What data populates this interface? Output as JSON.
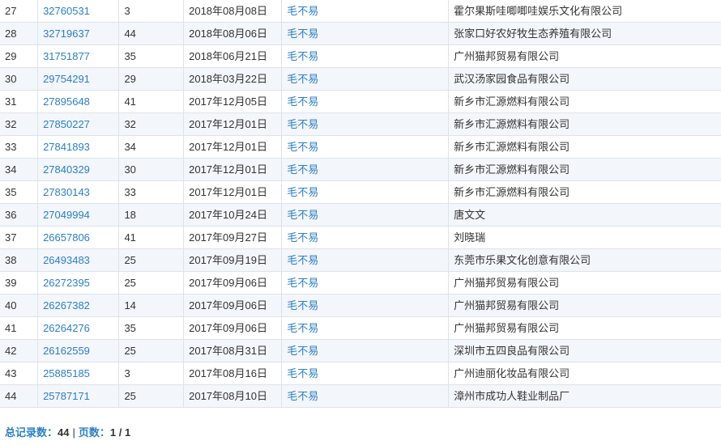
{
  "rows": [
    {
      "index": "27",
      "reg_no": "32760531",
      "class": "3",
      "date": "2018年08月08日",
      "status": "毛不易",
      "applicant": "霍尔果斯哇唧唧哇娱乐文化有限公司"
    },
    {
      "index": "28",
      "reg_no": "32719637",
      "class": "44",
      "date": "2018年08月06日",
      "status": "毛不易",
      "applicant": "张家口好农好牧生态养殖有限公司"
    },
    {
      "index": "29",
      "reg_no": "31751877",
      "class": "35",
      "date": "2018年06月21日",
      "status": "毛不易",
      "applicant": "广州猫邦贸易有限公司"
    },
    {
      "index": "30",
      "reg_no": "29754291",
      "class": "29",
      "date": "2018年03月22日",
      "status": "毛不易",
      "applicant": "武汉汤家园食品有限公司"
    },
    {
      "index": "31",
      "reg_no": "27895648",
      "class": "41",
      "date": "2017年12月05日",
      "status": "毛不易",
      "applicant": "新乡市汇源燃料有限公司"
    },
    {
      "index": "32",
      "reg_no": "27850227",
      "class": "32",
      "date": "2017年12月01日",
      "status": "毛不易",
      "applicant": "新乡市汇源燃料有限公司"
    },
    {
      "index": "33",
      "reg_no": "27841893",
      "class": "34",
      "date": "2017年12月01日",
      "status": "毛不易",
      "applicant": "新乡市汇源燃料有限公司"
    },
    {
      "index": "34",
      "reg_no": "27840329",
      "class": "30",
      "date": "2017年12月01日",
      "status": "毛不易",
      "applicant": "新乡市汇源燃料有限公司"
    },
    {
      "index": "35",
      "reg_no": "27830143",
      "class": "33",
      "date": "2017年12月01日",
      "status": "毛不易",
      "applicant": "新乡市汇源燃料有限公司"
    },
    {
      "index": "36",
      "reg_no": "27049994",
      "class": "18",
      "date": "2017年10月24日",
      "status": "毛不易",
      "applicant": "唐文文"
    },
    {
      "index": "37",
      "reg_no": "26657806",
      "class": "41",
      "date": "2017年09月27日",
      "status": "毛不易",
      "applicant": "刘晓瑞"
    },
    {
      "index": "38",
      "reg_no": "26493483",
      "class": "25",
      "date": "2017年09月19日",
      "status": "毛不易",
      "applicant": "东莞市乐果文化创意有限公司"
    },
    {
      "index": "39",
      "reg_no": "26272395",
      "class": "25",
      "date": "2017年09月06日",
      "status": "毛不易",
      "applicant": "广州猫邦贸易有限公司"
    },
    {
      "index": "40",
      "reg_no": "26267382",
      "class": "14",
      "date": "2017年09月06日",
      "status": "毛不易",
      "applicant": "广州猫邦贸易有限公司"
    },
    {
      "index": "41",
      "reg_no": "26264276",
      "class": "35",
      "date": "2017年09月06日",
      "status": "毛不易",
      "applicant": "广州猫邦贸易有限公司"
    },
    {
      "index": "42",
      "reg_no": "26162559",
      "class": "25",
      "date": "2017年08月31日",
      "status": "毛不易",
      "applicant": "深圳市五四良品有限公司"
    },
    {
      "index": "43",
      "reg_no": "25885185",
      "class": "3",
      "date": "2017年08月16日",
      "status": "毛不易",
      "applicant": "广州迪丽化妆品有限公司"
    },
    {
      "index": "44",
      "reg_no": "25787171",
      "class": "25",
      "date": "2017年08月10日",
      "status": "毛不易",
      "applicant": "漳州市成功人鞋业制品厂"
    }
  ],
  "summary": {
    "total_label": "总记录数：",
    "total_value": "44",
    "separator": "|",
    "pages_label": "页数：",
    "pages_value": "1 / 1"
  },
  "colors": {
    "link": "#2b7fc8",
    "alt_row": "#f3f6fa",
    "border": "#dde3ea",
    "text": "#333333"
  }
}
